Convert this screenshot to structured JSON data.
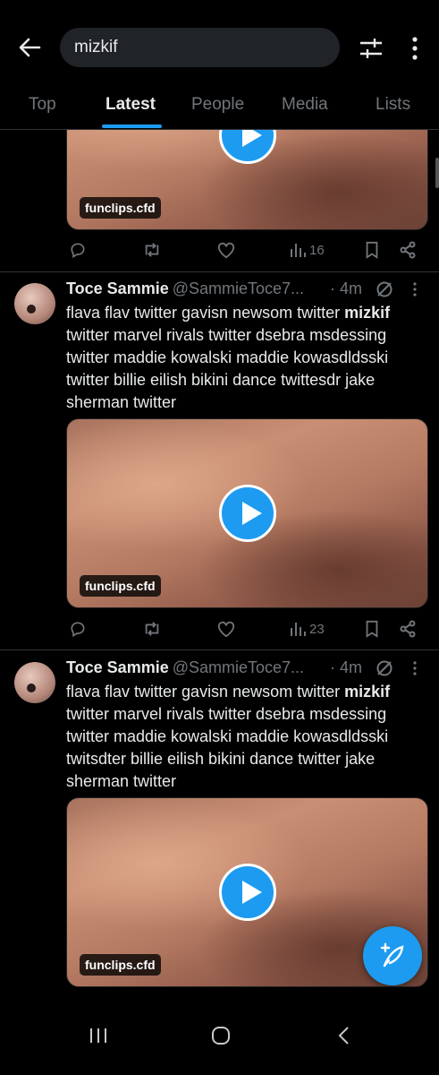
{
  "search": {
    "query": "mizkif"
  },
  "tabs": [
    "Top",
    "Latest",
    "People",
    "Media",
    "Lists"
  ],
  "active_tab": "Latest",
  "posts": [
    {
      "media_domain": "funclips.cfd",
      "views": "16"
    },
    {
      "author_name": "Toce Sammie",
      "author_handle": "@SammieToce7...",
      "time_sep": "·",
      "time": "4m",
      "text_pre": "flava flav twitter gavisn newsom twitter ",
      "text_highlight": "mizkif",
      "text_post": " twitter marvel rivals twitter dsebra msdessing twitter maddie kowalski maddie kowasdldsski twitter billie eilish bikini dance twittesdr jake sherman twitter",
      "media_domain": "funclips.cfd",
      "views": "23"
    },
    {
      "author_name": "Toce Sammie",
      "author_handle": "@SammieToce7...",
      "time_sep": "·",
      "time": "4m",
      "text_pre": "flava flav twitter gavisn newsom twitter ",
      "text_highlight": "mizkif",
      "text_post": " twitter marvel rivals twitter dsebra msdessing twitter maddie kowalski maddie kowasdldsski twitsdter billie eilish bikini dance twitter jake sherman twitter",
      "media_domain": "funclips.cfd",
      "views": ""
    }
  ],
  "icons": {
    "back": "arrow-left-icon",
    "filter": "sliders-icon",
    "more": "more-vertical-icon",
    "reply": "reply-icon",
    "repost": "repost-icon",
    "like": "heart-icon",
    "views": "bar-chart-icon",
    "bookmark": "bookmark-icon",
    "share": "share-icon",
    "compose": "compose-feather-icon"
  },
  "colors": {
    "accent": "#1d9bf0",
    "background": "#000000",
    "muted": "#71767b",
    "text": "#e7e9ea"
  }
}
